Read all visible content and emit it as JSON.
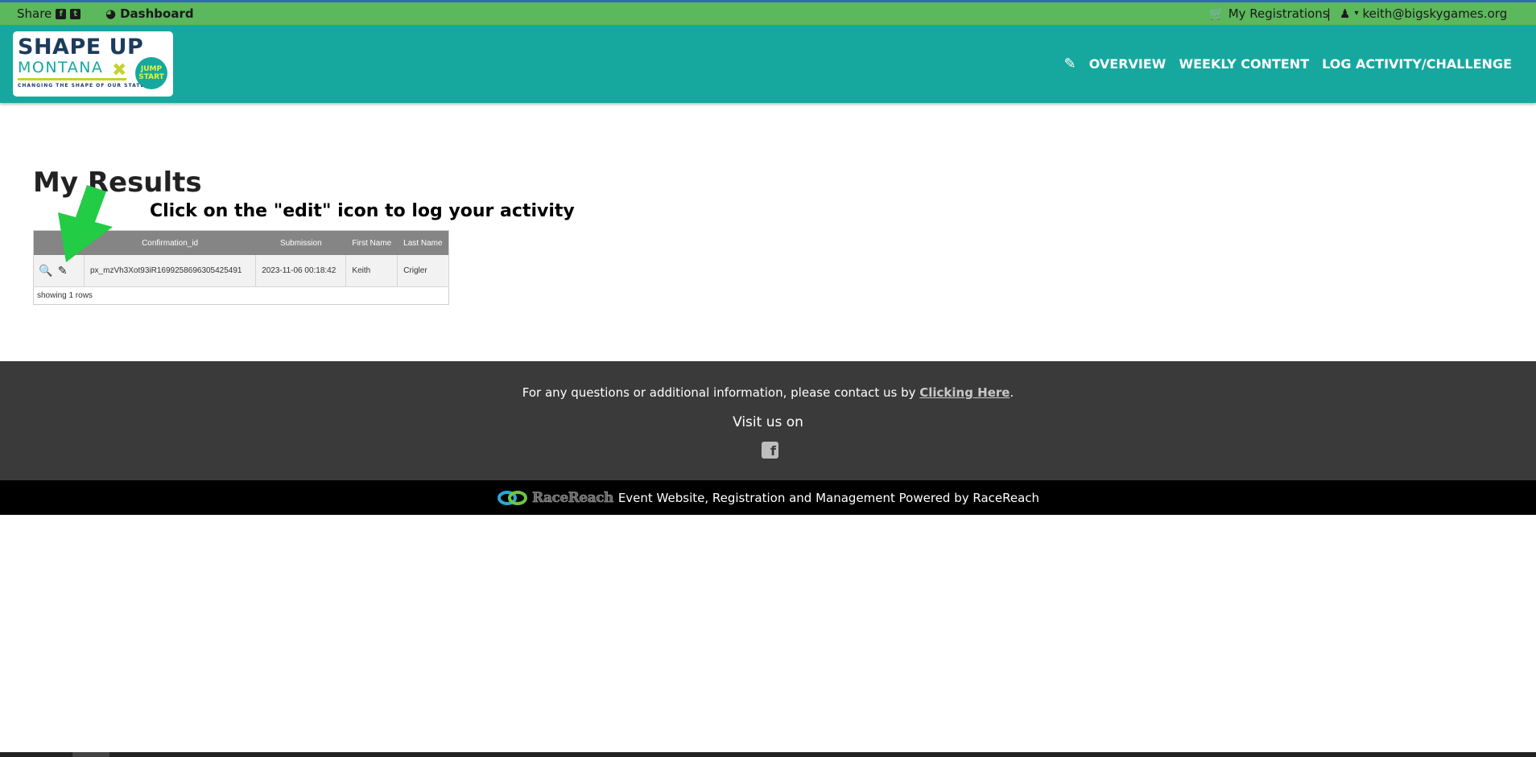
{
  "topbar": {
    "share_label": "Share",
    "dashboard_label": "Dashboard",
    "registrations_label": "My Registrations",
    "separator": "|",
    "user_email": "keith@bigskygames.org"
  },
  "logo": {
    "line1": "SHAPE UP",
    "line2": "MONTANA",
    "tagline": "CHANGING THE SHAPE OF OUR STATE",
    "badge_line1": "JUMP",
    "badge_line2": "START"
  },
  "nav": {
    "items": [
      {
        "label": "OVERVIEW"
      },
      {
        "label": "WEEKLY CONTENT"
      },
      {
        "label": "LOG ACTIVITY/CHALLENGE"
      }
    ]
  },
  "main": {
    "title": "My Results",
    "instruction": "Click on the \"edit\" icon to log your activity"
  },
  "table": {
    "headers": [
      "",
      "Confirmation_id",
      "Submission",
      "First Name",
      "Last Name"
    ],
    "rows": [
      {
        "confirmation_id": "px_mzVh3Xot93iR1699258696305425491",
        "submission": "2023-11-06 00:18:42",
        "first_name": "Keith",
        "last_name": "Crigler"
      }
    ],
    "footer_text": "showing 1 rows"
  },
  "footer": {
    "question_text": "For any questions or additional information, please contact us by ",
    "link_text": "Clicking Here",
    "period": ".",
    "visit_text": "Visit us on"
  },
  "powered": {
    "brand": "RaceReach",
    "text": "Event Website, Registration and Management Powered by RaceReach"
  },
  "colors": {
    "topbar": "#5cb85c",
    "header": "#16a89f",
    "footer": "#3a3a3a",
    "arrow": "#22cc44"
  }
}
